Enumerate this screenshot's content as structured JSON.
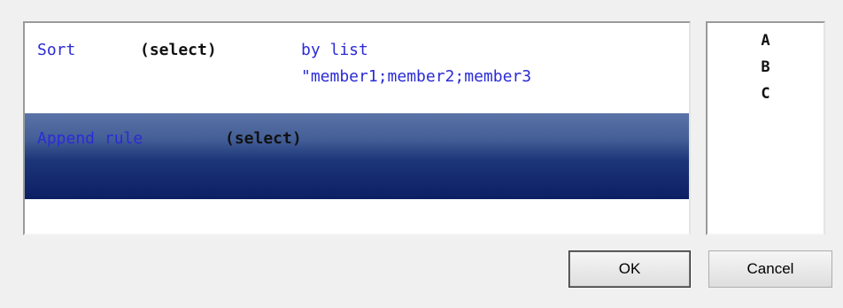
{
  "rules": [
    {
      "keyword": "Sort",
      "selector": "(select)",
      "option": "by list",
      "value": "\"member1;member2;member3"
    },
    {
      "keyword": "Append rule",
      "selector": "(select)"
    }
  ],
  "list": {
    "items": [
      "A",
      "B",
      "C"
    ]
  },
  "buttons": {
    "ok": "OK",
    "cancel": "Cancel"
  },
  "colors": {
    "keyword_text": "#2b2bd6",
    "selected_row_top": "#5a73a7",
    "selected_row_bottom": "#0c1f64"
  }
}
